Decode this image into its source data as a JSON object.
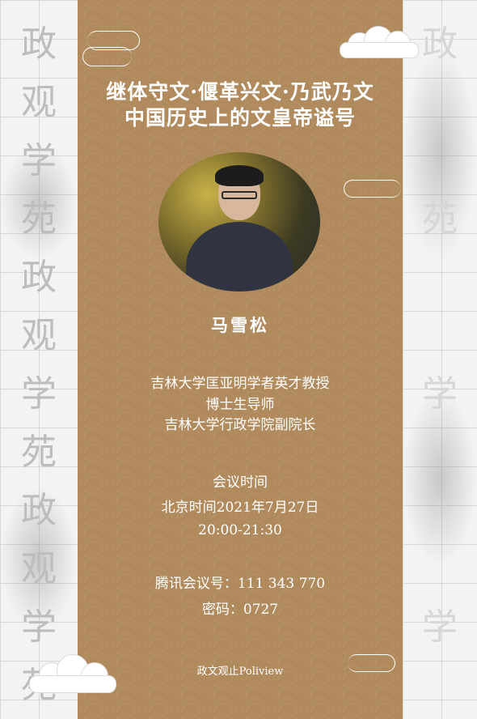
{
  "title_line1": "继体守文·偃革兴文·乃武乃文",
  "title_line2": "中国历史上的文皇帝谥号",
  "speaker": {
    "name": "马雪松",
    "titles": [
      "吉林大学匡亚明学者英才教授",
      "博士生导师",
      "吉林大学行政学院副院长"
    ]
  },
  "meeting": {
    "label": "会议时间",
    "date": "北京时间2021年7月27日",
    "time": "20:00-21:30",
    "tencent_id": "腾讯会议号：111 343 770",
    "password": "密码：0727"
  },
  "footer": "政文观止Poliview",
  "side_chars": [
    "政",
    "观",
    "学",
    "苑",
    "政",
    "观",
    "学",
    "苑",
    "政",
    "观",
    "学",
    "苑"
  ],
  "colors": {
    "panel": "#b08a5c",
    "text": "#ffffff",
    "paper": "#f3f3f1"
  }
}
